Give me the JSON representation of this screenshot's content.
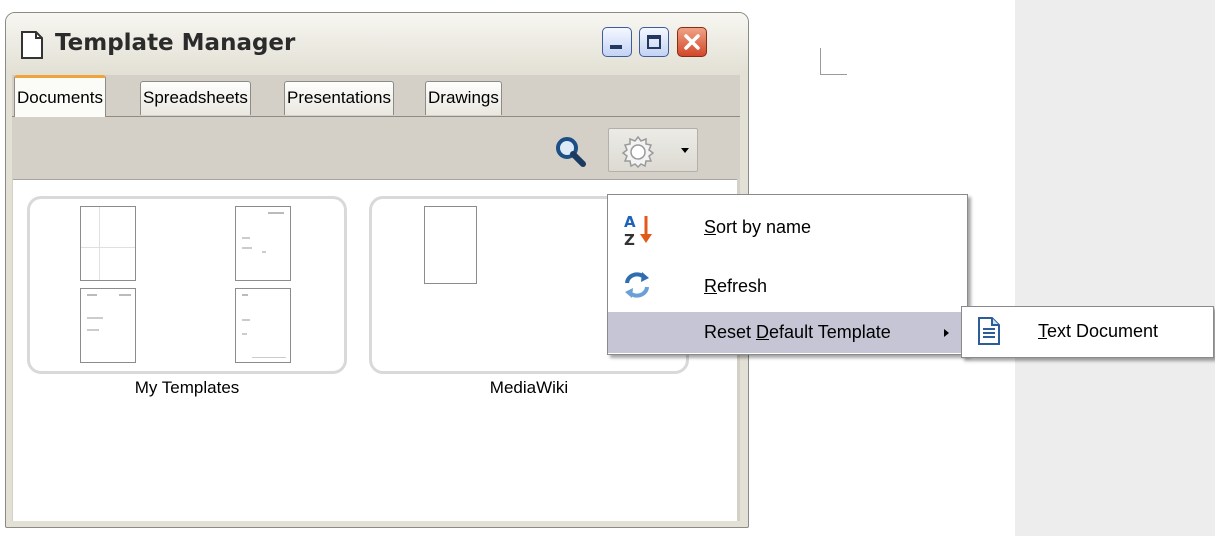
{
  "window": {
    "title": "Template Manager",
    "icon": "document-icon"
  },
  "tabs": [
    {
      "label": "Documents",
      "active": true
    },
    {
      "label": "Spreadsheets",
      "active": false
    },
    {
      "label": "Presentations",
      "active": false
    },
    {
      "label": "Drawings",
      "active": false
    }
  ],
  "toolbar": {
    "search_icon": "magnifier-icon",
    "action_icon": "gear-icon"
  },
  "folders": [
    {
      "label": "My Templates",
      "thumbnail_count": 4
    },
    {
      "label": "MediaWiki",
      "thumbnail_count": 1
    }
  ],
  "context_menu": {
    "items": [
      {
        "label_underlined": "S",
        "label_rest": "ort by name",
        "icon": "sort-az-icon"
      },
      {
        "label_underlined": "R",
        "label_rest": "efresh",
        "icon": "refresh-icon"
      },
      {
        "label_before": "Reset ",
        "label_underlined": "D",
        "label_rest": "efault Template",
        "has_submenu": true,
        "highlighted": true
      }
    ],
    "submenu": {
      "items": [
        {
          "label_underlined": "T",
          "label_rest": "ext Document",
          "icon": "text-document-icon"
        }
      ]
    }
  },
  "colors": {
    "active_tab_accent": "#f0a33b",
    "menu_highlight": "#c5c5d5",
    "close_button": "#d2472a"
  }
}
